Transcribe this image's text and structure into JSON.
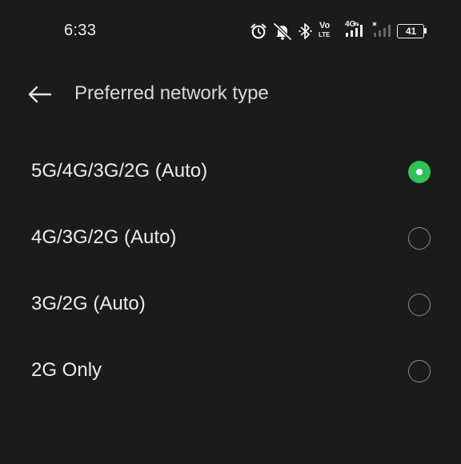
{
  "status_bar": {
    "time": "6:33",
    "battery_level": "41",
    "network_label": "4G",
    "volte_top": "Vo",
    "volte_bottom": "LTE",
    "icons": [
      "alarm-icon",
      "silent-bell-icon",
      "bluetooth-icon",
      "volte-icon",
      "signal-4g-icon",
      "signal-no-service-icon",
      "battery-icon"
    ]
  },
  "header": {
    "back_icon": "arrow-left-icon",
    "title": "Preferred network type"
  },
  "options": [
    {
      "label": "5G/4G/3G/2G (Auto)",
      "selected": true
    },
    {
      "label": "4G/3G/2G (Auto)",
      "selected": false
    },
    {
      "label": "3G/2G (Auto)",
      "selected": false
    },
    {
      "label": "2G Only",
      "selected": false
    }
  ],
  "colors": {
    "background": "#1b1b1b",
    "accent": "#2fc25a",
    "text": "#ececec",
    "radio_border": "#8a8a8a"
  }
}
